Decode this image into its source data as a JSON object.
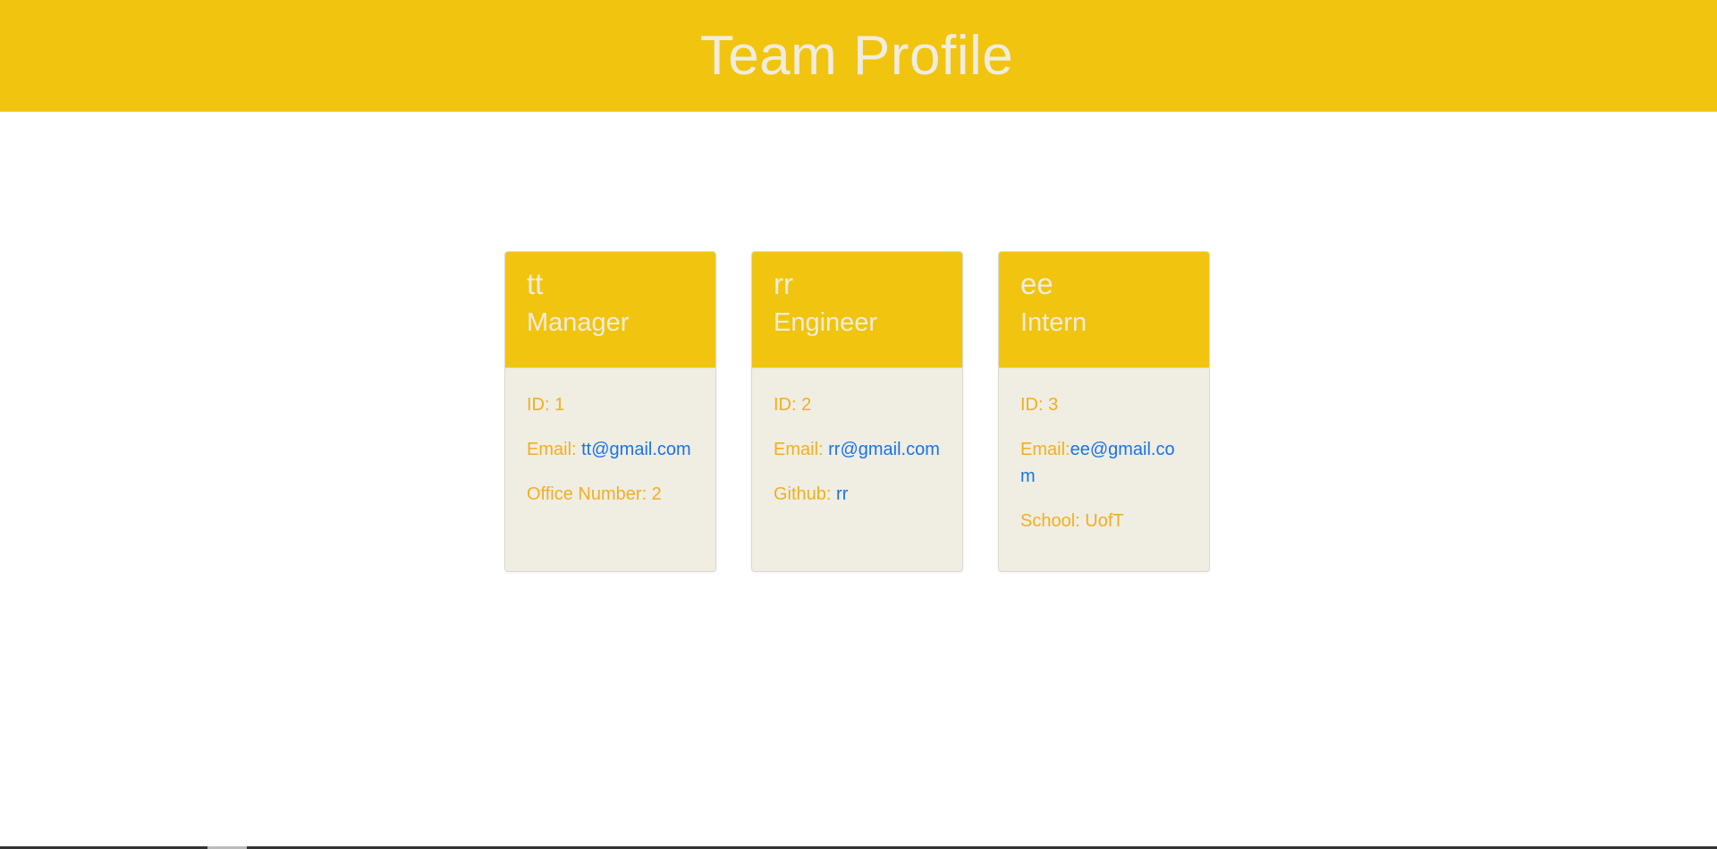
{
  "header": {
    "title": "Team Profile"
  },
  "colors": {
    "accent": "#f1c40f",
    "card_body": "#f0ede3",
    "label_text": "#f0b01e",
    "link": "#1a73e8",
    "header_text": "#f0ecdf"
  },
  "cards": [
    {
      "name": "tt",
      "role": "Manager",
      "id_text": "ID: 1",
      "email_label": "Email: ",
      "email": "tt@gmail.com",
      "extra_label": "Office Number: 2",
      "extra_value": ""
    },
    {
      "name": "rr",
      "role": "Engineer",
      "id_text": "ID: 2",
      "email_label": "Email: ",
      "email": "rr@gmail.com",
      "extra_label": "Github: ",
      "extra_value": "rr"
    },
    {
      "name": "ee",
      "role": "Intern",
      "id_text": "ID: 3",
      "email_label": "Email:",
      "email": "ee@gmail.com",
      "extra_label": "School: UofT",
      "extra_value": ""
    }
  ]
}
